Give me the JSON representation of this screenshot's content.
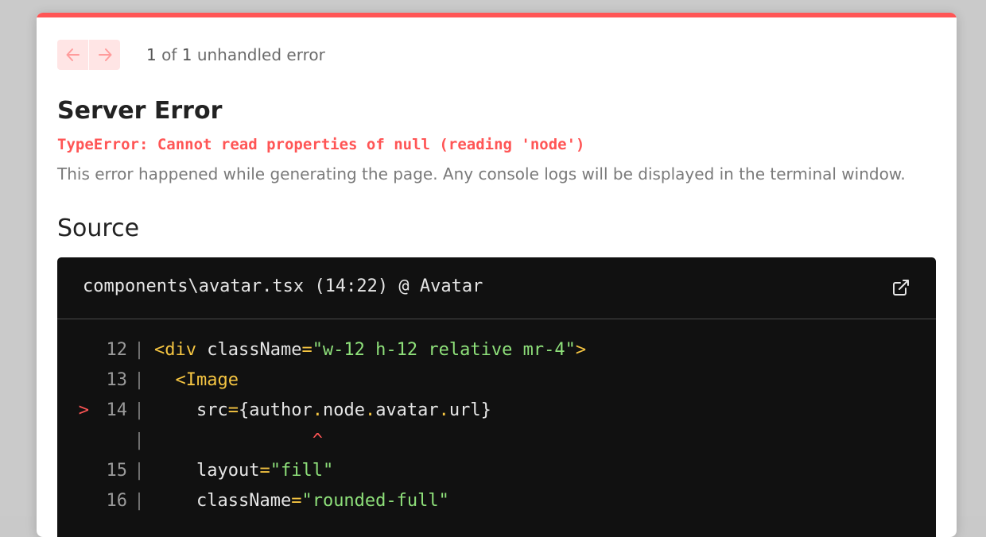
{
  "nav": {
    "current": "1",
    "total": "1",
    "of_text": " of ",
    "suffix": " unhandled error"
  },
  "error": {
    "title": "Server Error",
    "message": "TypeError: Cannot read properties of null (reading 'node')",
    "description": "This error happened while generating the page. Any console logs will be displayed in the terminal window."
  },
  "source": {
    "heading": "Source",
    "file": "components\\avatar.tsx (14:22) @ Avatar",
    "lines": [
      {
        "num": "12",
        "indent": "",
        "parts": [
          [
            "tag",
            "<div"
          ],
          [
            "attr",
            " className"
          ],
          [
            "eq",
            "="
          ],
          [
            "str",
            "\"w-12 h-12 relative mr-4\""
          ],
          [
            "tag",
            ">"
          ]
        ]
      },
      {
        "num": "13",
        "indent": "  ",
        "parts": [
          [
            "tag",
            "<Image"
          ]
        ]
      },
      {
        "num": "14",
        "indent": "    ",
        "marker": ">",
        "parts": [
          [
            "attr",
            "src"
          ],
          [
            "eq",
            "="
          ],
          [
            "attr",
            "{author"
          ],
          [
            "dot",
            "."
          ],
          [
            "attr",
            "node"
          ],
          [
            "dot",
            "."
          ],
          [
            "attr",
            "avatar"
          ],
          [
            "dot",
            "."
          ],
          [
            "attr",
            "url}"
          ]
        ]
      },
      {
        "num": "",
        "indent": "               ",
        "parts": [
          [
            "caret",
            "^"
          ]
        ]
      },
      {
        "num": "15",
        "indent": "    ",
        "parts": [
          [
            "attr",
            "layout"
          ],
          [
            "eq",
            "="
          ],
          [
            "str",
            "\"fill\""
          ]
        ]
      },
      {
        "num": "16",
        "indent": "    ",
        "parts": [
          [
            "attr",
            "className"
          ],
          [
            "eq",
            "="
          ],
          [
            "str",
            "\"rounded-full\""
          ]
        ]
      }
    ]
  },
  "colors": {
    "accent": "#ff5555",
    "code_bg": "#111111",
    "tag": "#f5c542",
    "string": "#8ee07a"
  },
  "icons": {
    "prev": "arrow-left-icon",
    "next": "arrow-right-icon",
    "open": "external-link-icon"
  }
}
